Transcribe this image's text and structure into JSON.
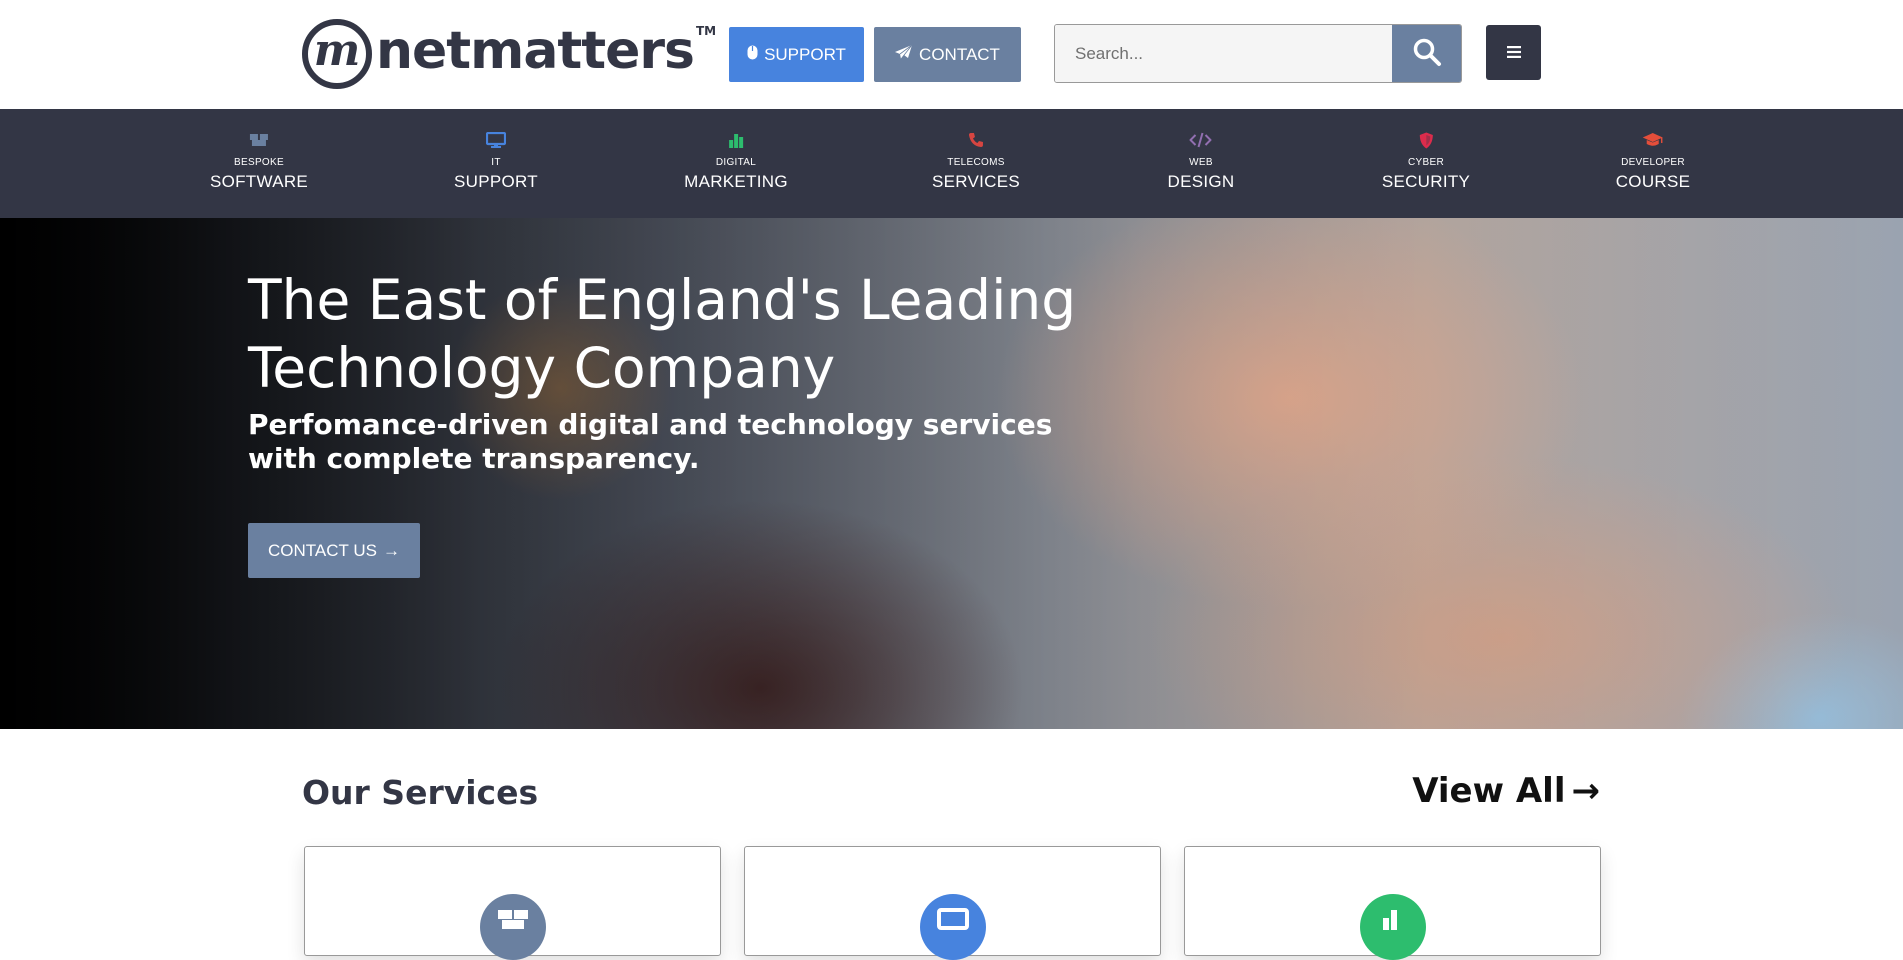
{
  "header": {
    "logo_text": "netmatters",
    "logo_mark": "m",
    "logo_tm": "TM",
    "support_label": "SUPPORT",
    "support_icon": "mouse-icon",
    "contact_label": "CONTACT",
    "contact_icon": "paper-plane-icon",
    "search_placeholder": "Search...",
    "search_icon": "search-icon",
    "menu_icon": "hamburger-icon"
  },
  "nav": {
    "items": [
      {
        "small": "BESPOKE",
        "big": "SOFTWARE",
        "icon": "boxes-icon",
        "color": "#6a80a0"
      },
      {
        "small": "IT",
        "big": "SUPPORT",
        "icon": "desktop-icon",
        "color": "#4783de"
      },
      {
        "small": "DIGITAL",
        "big": "MARKETING",
        "icon": "bar-chart-icon",
        "color": "#2dbd6e"
      },
      {
        "small": "TELECOMS",
        "big": "SERVICES",
        "icon": "phone-icon",
        "color": "#d64541"
      },
      {
        "small": "WEB",
        "big": "DESIGN",
        "icon": "code-icon",
        "color": "#926fb1"
      },
      {
        "small": "CYBER",
        "big": "SECURITY",
        "icon": "shield-icon",
        "color": "#dd2c4c"
      },
      {
        "small": "DEVELOPER",
        "big": "COURSE",
        "icon": "graduation-cap-icon",
        "color": "#e54e3a"
      }
    ]
  },
  "hero": {
    "title": "The East of England's Leading Technology Company",
    "subtitle": "Perfomance-driven digital and technology services with complete transparency.",
    "cta_label": "CONTACT US",
    "cta_arrow": "→"
  },
  "services": {
    "title": "Our Services",
    "view_all_label": "View All",
    "view_all_arrow": "→",
    "cards": [
      {
        "icon": "boxes-icon",
        "color": "#6a80a0"
      },
      {
        "icon": "desktop-icon",
        "color": "#4783de"
      },
      {
        "icon": "bar-chart-icon",
        "color": "#2dbd6e"
      }
    ]
  },
  "colors": {
    "dark": "#333645",
    "support_blue": "#4783de",
    "slate": "#6a80a0"
  }
}
